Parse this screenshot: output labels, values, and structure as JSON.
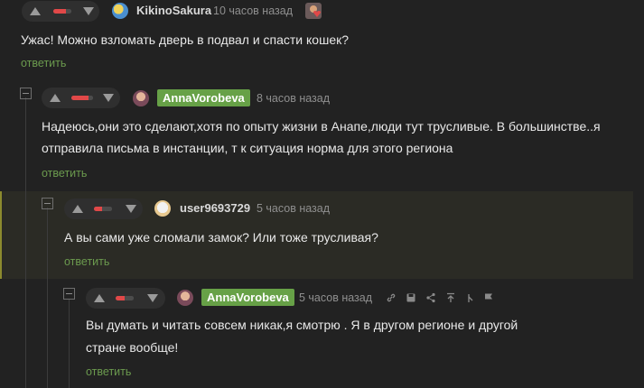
{
  "comments": [
    {
      "username": "KikinoSakura",
      "time": "10 часов назад",
      "text": "Ужас! Можно взломать дверь в подвал и спасти кошек?",
      "reply_label": "ответить",
      "rating_negative_fraction": 0.7
    },
    {
      "username": "AnnaVorobeva",
      "time": "8 часов назад",
      "text_line1": "Надеюсь,они это сделают,хотя по опыту жизни в Анапе,люди тут трусливые. В большинстве..я",
      "text_line2": "отправила письма в инстанции, т к ситуация норма для этого региона",
      "reply_label": "ответить",
      "rating_negative_fraction": 0.8
    },
    {
      "username": "user9693729",
      "time": "5 часов назад",
      "text": "А вы сами уже сломали замок? Или тоже трусливая?",
      "reply_label": "ответить",
      "rating_negative_fraction": 0.45
    },
    {
      "username": "AnnaVorobeva",
      "time": "5 часов назад",
      "text_line1": "Вы думать и читать совсем никак,я смотрю . Я в другом регионе и другой",
      "text_line2": "стране вообще!",
      "reply_label": "ответить",
      "rating_negative_fraction": 0.5
    }
  ],
  "toolbar_icons": [
    "link-icon",
    "save-icon",
    "share-icon",
    "scroll-top-icon",
    "branch-icon",
    "flag-icon"
  ],
  "colors": {
    "background": "#222222",
    "highlight_background": "#2b2b25",
    "highlight_border": "#8c8a2e",
    "author_badge": "#67a147",
    "reply_link": "#6b9a4e",
    "rating_negative": "#e14848"
  }
}
